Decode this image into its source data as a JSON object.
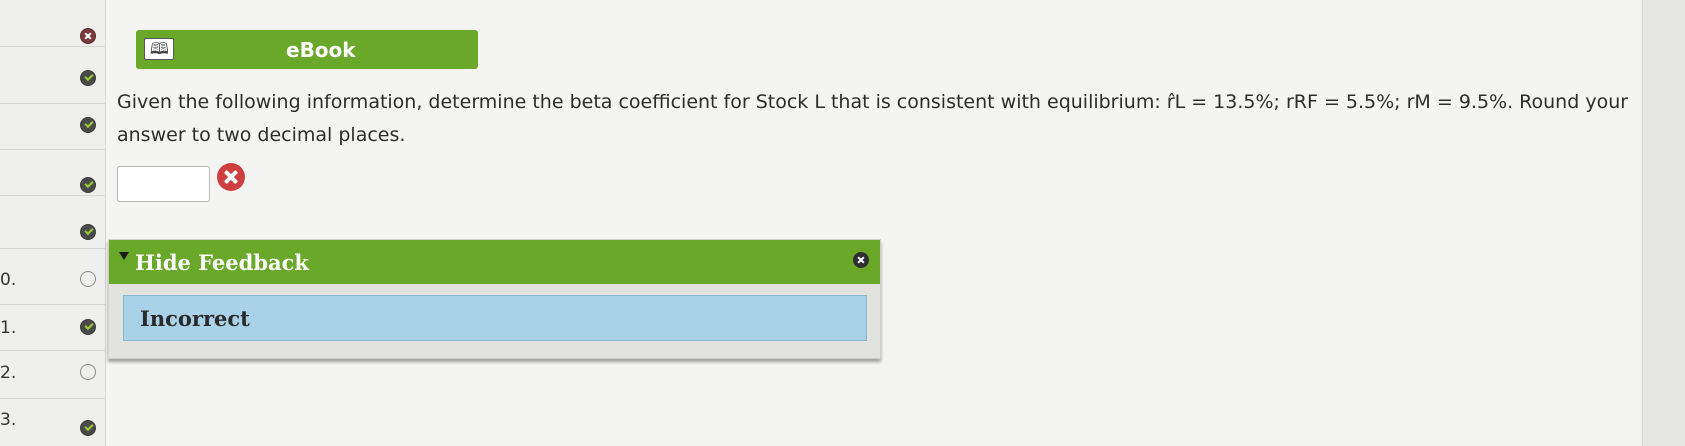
{
  "sidebar": {
    "questions": [
      {
        "num": "",
        "status": "incorrect"
      },
      {
        "num": "",
        "status": "correct"
      },
      {
        "num": "",
        "status": "correct"
      },
      {
        "num": "",
        "status": "correct"
      },
      {
        "num": "",
        "status": "correct"
      },
      {
        "num": "0.",
        "status": "unanswered"
      },
      {
        "num": "1.",
        "status": "correct"
      },
      {
        "num": "2.",
        "status": "unanswered"
      },
      {
        "num": "3.",
        "status": "correct"
      }
    ]
  },
  "ebook": {
    "label": "eBook",
    "icon": "book-icon"
  },
  "question": {
    "text": "Given the following information, determine the beta coefficient for Stock L that is consistent with equilibrium: r̂L = 13.5%; rRF = 5.5%; rM = 9.5%. Round your answer to two decimal places."
  },
  "answer": {
    "value": "",
    "status_icon": "incorrect-icon"
  },
  "feedback": {
    "toggle_label": "Hide Feedback",
    "result": "Incorrect",
    "close_icon": "close-icon"
  },
  "colors": {
    "accent_green": "#6aa82a",
    "feedback_blue": "#a9d2e8",
    "error_red": "#d03f3f"
  }
}
